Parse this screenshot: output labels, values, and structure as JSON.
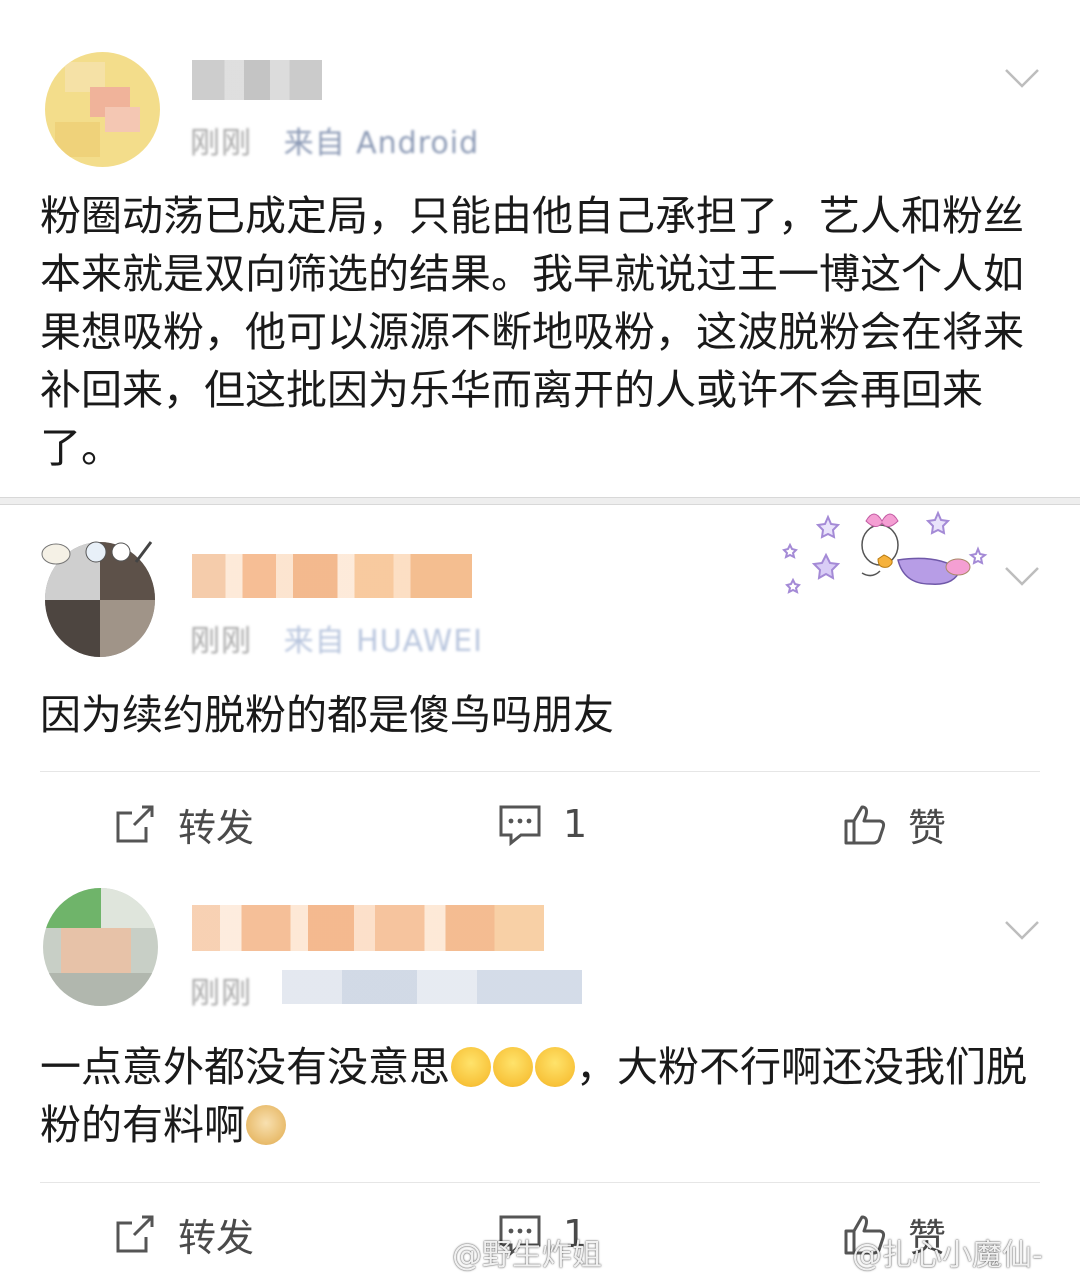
{
  "comments": [
    {
      "meta_time": "刚刚",
      "meta_source": "来自 Android",
      "text": "粉圈动荡已成定局，只能由他自己承担了，艺人和粉丝本来就是双向筛选的结果。我早就说过王一博这个人如果想吸粉，他可以源源不断地吸粉，这波脱粉会在将来补回来，但这批因为乐华而离开的人或许不会再回来了。"
    },
    {
      "meta_time": "刚刚",
      "meta_source": "来自 HUAWEI",
      "text": "因为续约脱粉的都是傻鸟吗朋友",
      "actions": {
        "repost": "转发",
        "comment_count": "1",
        "like": "赞"
      }
    },
    {
      "meta_time": "刚刚",
      "text_before_emoji": "一点意外都没有没意思",
      "text_after_emoji": "，大粉不行啊还没我们脱粉的有料啊",
      "emojis": [
        "crying-emoji",
        "crying-emoji",
        "crying-emoji",
        "doge-emoji"
      ],
      "actions": {
        "repost": "转发",
        "comment_count": "1",
        "like": "赞"
      }
    }
  ],
  "watermarks": {
    "left": "@野生炸姐",
    "right": "@扎心小魔仙-"
  },
  "colors": {
    "text": "#1a1a1a",
    "meta": "#a7a7a7",
    "action": "#4a4a4a",
    "blur_orange": "#f4b07a"
  }
}
